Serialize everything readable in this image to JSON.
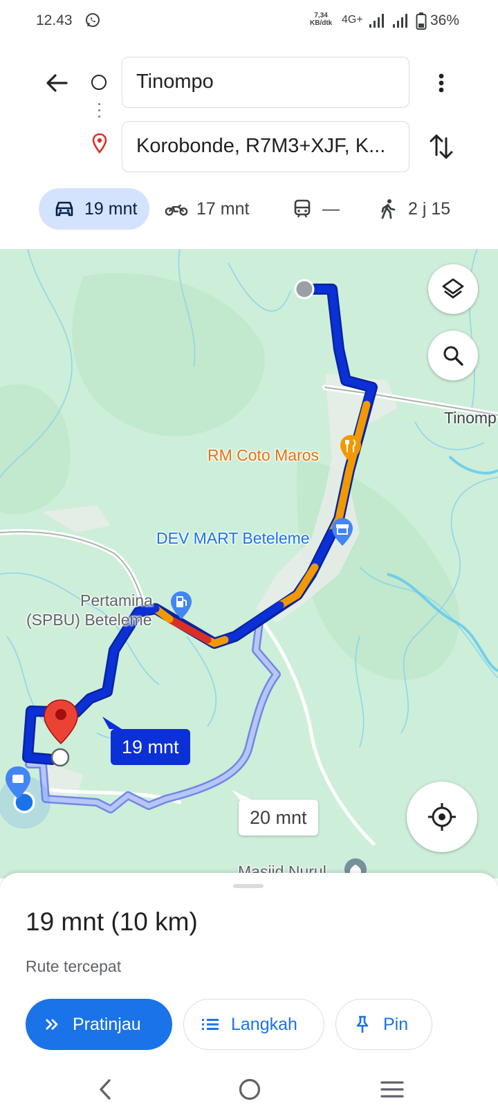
{
  "status_bar": {
    "time": "12.43",
    "speed_value": "7,34",
    "speed_unit": "KB/dtk",
    "network": "4G+",
    "battery": "36%"
  },
  "directions": {
    "origin": "Tinompo",
    "destination": "Korobonde, R7M3+XJF, K..."
  },
  "travel_modes": [
    {
      "mode": "car",
      "label": "19 mnt",
      "selected": true,
      "icon": "car-icon"
    },
    {
      "mode": "motorcycle",
      "label": "17 mnt",
      "selected": false,
      "icon": "motorcycle-icon"
    },
    {
      "mode": "transit",
      "label": "—",
      "selected": false,
      "icon": "train-icon"
    },
    {
      "mode": "walk",
      "label": "2 j 15",
      "selected": false,
      "icon": "walking-icon"
    }
  ],
  "map": {
    "labels": {
      "tinompo": "Tinomp",
      "rm_coto_maros": "RM Coto Maros",
      "dev_mart": "DEV MART Beteleme",
      "pertamina_line1": "Pertamina",
      "pertamina_line2": "(SPBU) Beteleme",
      "masjid": "Masjid Nurul"
    },
    "route_time_primary": "19 mnt",
    "route_time_alternative": "20 mnt",
    "colors": {
      "route_primary": "#0b30d6",
      "traffic_slow": "#f29900",
      "traffic_heavy": "#d93025",
      "route_alternative": "#9fb3f4",
      "map_background": "#cdeed8"
    }
  },
  "route_summary": {
    "title": "19 mnt (10 km)",
    "subtitle": "Rute tercepat"
  },
  "actions": {
    "preview": "Pratinjau",
    "steps": "Langkah",
    "pin": "Pin"
  }
}
